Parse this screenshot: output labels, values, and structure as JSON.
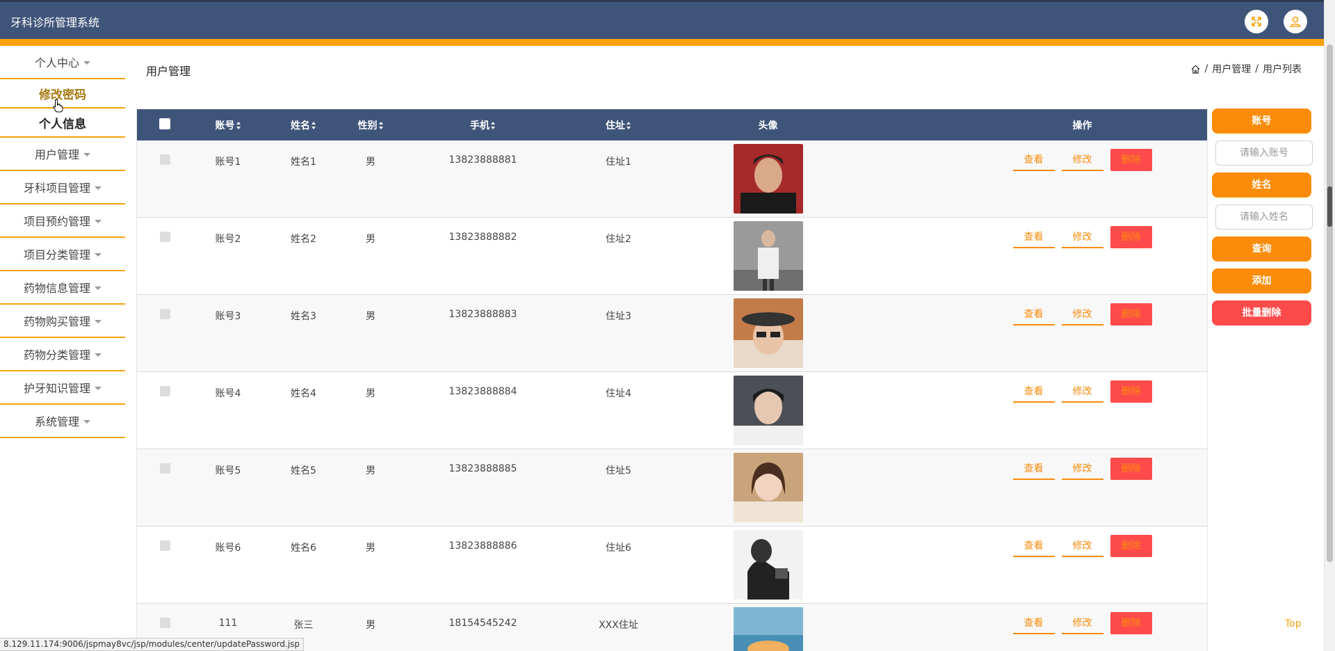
{
  "app": {
    "title": "牙科诊所管理系统"
  },
  "topbar": {
    "fullscreen_icon": "fullscreen-icon",
    "user_icon": "user-icon"
  },
  "sidebar": {
    "items": [
      {
        "label": "个人中心",
        "expanded": true,
        "children": [
          {
            "label": "修改密码",
            "active": true
          },
          {
            "label": "个人信息",
            "active": false
          }
        ]
      },
      {
        "label": "用户管理"
      },
      {
        "label": "牙科项目管理"
      },
      {
        "label": "项目预约管理"
      },
      {
        "label": "项目分类管理"
      },
      {
        "label": "药物信息管理"
      },
      {
        "label": "药物购买管理"
      },
      {
        "label": "药物分类管理"
      },
      {
        "label": "护牙知识管理"
      },
      {
        "label": "系统管理"
      }
    ]
  },
  "header": {
    "page_title": "用户管理",
    "breadcrumb": {
      "home_icon": "home-icon",
      "sep": "/",
      "level1": "用户管理",
      "level2": "用户列表"
    }
  },
  "table": {
    "columns": [
      "账号",
      "姓名",
      "性别",
      "手机",
      "住址",
      "头像",
      "操作"
    ],
    "rows": [
      {
        "account": "账号1",
        "name": "姓名1",
        "sex": "男",
        "phone": "13823888881",
        "address": "住址1"
      },
      {
        "account": "账号2",
        "name": "姓名2",
        "sex": "男",
        "phone": "13823888882",
        "address": "住址2"
      },
      {
        "account": "账号3",
        "name": "姓名3",
        "sex": "男",
        "phone": "13823888883",
        "address": "住址3"
      },
      {
        "account": "账号4",
        "name": "姓名4",
        "sex": "男",
        "phone": "13823888884",
        "address": "住址4"
      },
      {
        "account": "账号5",
        "name": "姓名5",
        "sex": "男",
        "phone": "13823888885",
        "address": "住址5"
      },
      {
        "account": "账号6",
        "name": "姓名6",
        "sex": "男",
        "phone": "13823888886",
        "address": "住址6"
      },
      {
        "account": "111",
        "name": "张三",
        "sex": "男",
        "phone": "18154545242",
        "address": "XXX住址"
      }
    ],
    "actions": {
      "view": "查看",
      "edit": "修改",
      "delete": "删除"
    }
  },
  "search_panel": {
    "account_label": "账号",
    "account_placeholder": "请输入账号",
    "name_label": "姓名",
    "name_placeholder": "请输入姓名",
    "query": "查询",
    "add": "添加",
    "batch_delete": "批量删除"
  },
  "footer": {
    "top_link": "Top",
    "status_url": "8.129.11.174:9006/jspmay8vc/jsp/modules/center/updatePassword.jsp"
  },
  "colors": {
    "header_bg": "#3f5479",
    "accent": "#f9a20b",
    "button": "#fa8c0a",
    "danger": "#fd4b4b"
  }
}
